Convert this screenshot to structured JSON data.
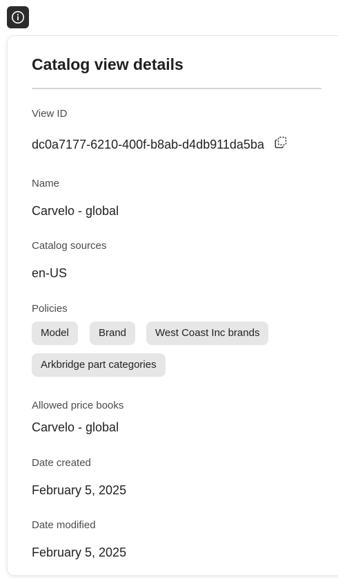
{
  "info_button": {
    "icon": "info-icon"
  },
  "panel": {
    "title": "Catalog view details",
    "view_id": {
      "label": "View ID",
      "value": "dc0a7177-6210-400f-b8ab-d4db911da5ba",
      "copy_icon": "copy-icon"
    },
    "name": {
      "label": "Name",
      "value": "Carvelo - global"
    },
    "catalog_sources": {
      "label": "Catalog sources",
      "value": "en-US"
    },
    "policies": {
      "label": "Policies",
      "tags": [
        "Model",
        "Brand",
        "West Coast Inc brands",
        "Arkbridge part categories"
      ]
    },
    "allowed_price_books": {
      "label": "Allowed price books",
      "value": "Carvelo - global"
    },
    "date_created": {
      "label": "Date created",
      "value": "February 5, 2025"
    },
    "date_modified": {
      "label": "Date modified",
      "value": "February 5, 2025"
    }
  }
}
